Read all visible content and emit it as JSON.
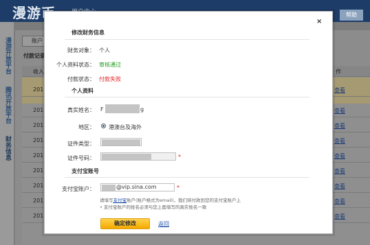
{
  "app": {
    "logo": "漫游币",
    "user_center": "用户中心",
    "help": "帮助"
  },
  "sidebar": {
    "items": [
      {
        "label": "漫游开放平台"
      },
      {
        "label": "腾讯开放平台"
      },
      {
        "label": "财务信息"
      }
    ]
  },
  "page": {
    "tab_label": "账户",
    "section_label": "付款记录",
    "table_headers": {
      "first": "收入",
      "last": "作"
    },
    "row_prefixes": [
      "201",
      "201",
      "201",
      "201",
      "201",
      "201",
      "201",
      "201",
      "201"
    ],
    "row_links": [
      "查看",
      "查看",
      "查看",
      "查看",
      "查看",
      "查看",
      "查看",
      "查看",
      "查看"
    ]
  },
  "modal": {
    "title": "修改财务信息",
    "close": "×",
    "finance": {
      "object_label": "财务对象：",
      "object_value": "个人",
      "profile_status_label": "个人资料状态：",
      "profile_status_value": "审核通过",
      "payment_status_label": "付款状态：",
      "payment_status_value": "付款失败"
    },
    "personal": {
      "title": "个人资料",
      "name_label": "真实姓名：",
      "name_prefix": "F",
      "name_suffix": "g",
      "region_label": "地区：",
      "region_option": "港澳台及海外",
      "id_type_label": "证件类型：",
      "id_number_label": "证件号码：",
      "required": "*"
    },
    "alipay": {
      "title": "支付宝账号",
      "account_label": "支付宝账户：",
      "account_value": "@vip.sina.com",
      "required": "*",
      "hint_line1_pre": "请填写",
      "hint_line1_link": "支付宝",
      "hint_line1_post": "账户(账户格式为email)，我们将付款到您的支付宝账户上",
      "hint_line2": "• 支付宝账户的姓名必须与您上面填写的真实姓名一致"
    },
    "confirm_button": "确定修改",
    "back_link": "返回"
  },
  "colors": {
    "status_ok": "#1f9a1f",
    "status_fail": "#e02020",
    "button": "#f5b400",
    "link": "#1f4fa8"
  }
}
